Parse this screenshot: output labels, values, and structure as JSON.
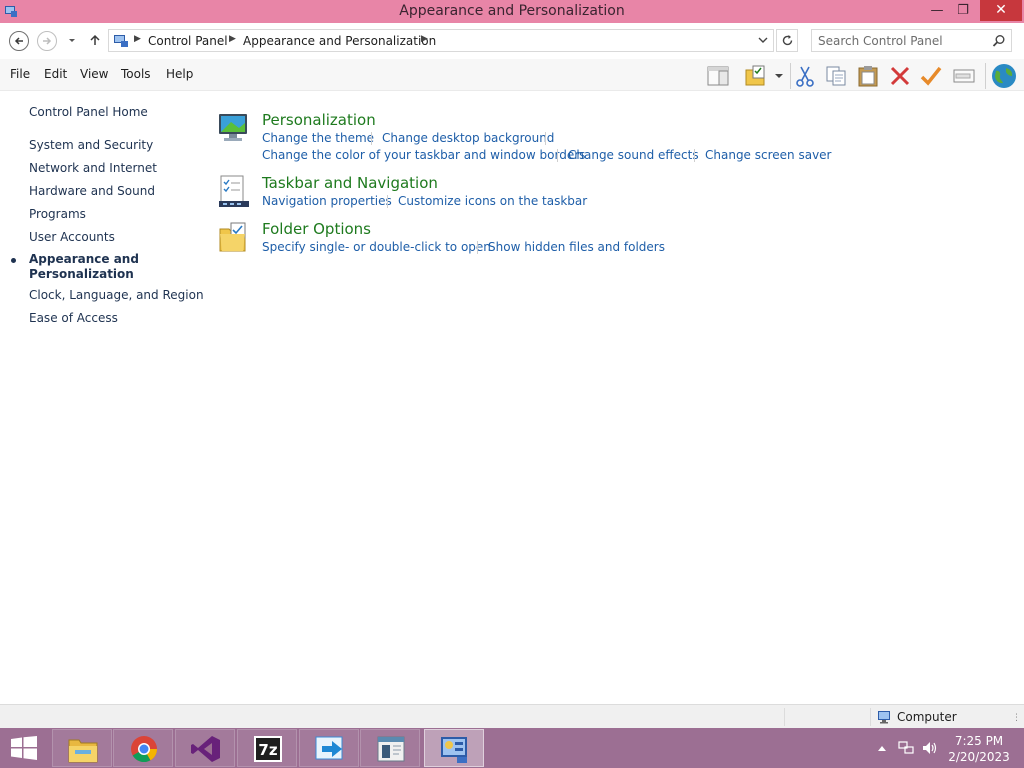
{
  "window": {
    "title": "Appearance and Personalization",
    "app_icon": "control-panel-icon",
    "controls": {
      "minimize": "minimize-icon",
      "maximize": "restore-icon",
      "close": "close-icon"
    }
  },
  "address": {
    "icon": "control-panel-icon",
    "breadcrumbs": [
      "Control Panel",
      "Appearance and Personalization"
    ],
    "search_placeholder": "Search Control Panel"
  },
  "menu": {
    "items": [
      "File",
      "Edit",
      "View",
      "Tools",
      "Help"
    ]
  },
  "toolbar": {
    "icons": [
      "preview-pane-icon",
      "folder-options-icon",
      "cut-icon",
      "copy-icon",
      "paste-icon",
      "delete-icon",
      "checkmark-icon",
      "address-bar-icon",
      "internet-globe-icon"
    ]
  },
  "sidebar": {
    "home": "Control Panel Home",
    "items": [
      "System and Security",
      "Network and Internet",
      "Hardware and Sound",
      "Programs",
      "User Accounts",
      "Appearance and Personalization",
      "Clock, Language, and Region",
      "Ease of Access"
    ],
    "current_line1": "Appearance and",
    "current_line2": "Personalization"
  },
  "categories": [
    {
      "title": "Personalization",
      "icon": "personalization-icon",
      "tasks_row1": [
        "Change the theme",
        "Change desktop background"
      ],
      "tasks_row2": [
        "Change the color of your taskbar and window borders",
        "Change sound effects",
        "Change screen saver"
      ]
    },
    {
      "title": "Taskbar and Navigation",
      "icon": "taskbar-icon",
      "tasks_row1": [
        "Navigation properties",
        "Customize icons on the taskbar"
      ]
    },
    {
      "title": "Folder Options",
      "icon": "folder-options-icon",
      "tasks_row1": [
        "Specify single- or double-click to open",
        "Show hidden files and folders"
      ]
    }
  ],
  "statusbar": {
    "zone": "Computer"
  },
  "taskbar": {
    "apps": [
      "file-explorer-icon",
      "chrome-icon",
      "visual-studio-icon",
      "7zip-icon",
      "remote-app-icon",
      "document-viewer-icon",
      "control-panel-icon"
    ],
    "active_index": 6,
    "time": "7:25 PM",
    "date": "2/20/2023"
  },
  "colors": {
    "titlebar": "#e885a7",
    "taskbar": "#9c6f93",
    "category_title": "#1e7a1e",
    "task_link": "#1e5ea8"
  }
}
